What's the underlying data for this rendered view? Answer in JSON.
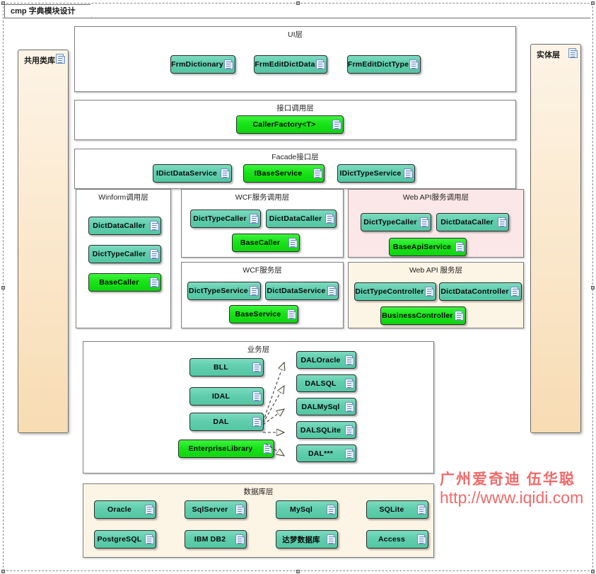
{
  "diagram": {
    "tab_title": "cmp 字典模块设计",
    "watermark_cn": "广州爱奇迪  伍华聪",
    "watermark_url": "http://www.iqidi.com"
  },
  "side_packages": [
    {
      "label": "共用类库",
      "icon": "document-icon"
    },
    {
      "label": "实体层",
      "icon": "document-icon"
    }
  ],
  "groups": [
    {
      "id": "ui",
      "title": "UI层",
      "bg": "white",
      "nodes": [
        {
          "label": "FrmDictionary",
          "style": "teal"
        },
        {
          "label": "FrmEditDictData",
          "style": "teal"
        },
        {
          "label": "FrmEditDictType",
          "style": "teal"
        }
      ]
    },
    {
      "id": "caller",
      "title": "接口调用层",
      "bg": "white",
      "nodes": [
        {
          "label": "CallerFactory<T>",
          "style": "lime"
        }
      ]
    },
    {
      "id": "facade",
      "title": "Facade接口层",
      "bg": "white",
      "nodes": [
        {
          "label": "IDictDataService",
          "style": "teal"
        },
        {
          "label": "IBaseService",
          "style": "lime"
        },
        {
          "label": "IDictTypeService",
          "style": "teal"
        }
      ]
    },
    {
      "id": "winform",
      "title": "Winform调用层",
      "bg": "white",
      "nodes": [
        {
          "label": "DictDataCaller",
          "style": "teal"
        },
        {
          "label": "DictTypeCaller",
          "style": "teal"
        },
        {
          "label": "BaseCaller",
          "style": "lime"
        }
      ]
    },
    {
      "id": "wcf-caller",
      "title": "WCF服务调用层",
      "bg": "white",
      "nodes": [
        {
          "label": "DictTypeCaller",
          "style": "teal"
        },
        {
          "label": "DictDataCaller",
          "style": "teal"
        },
        {
          "label": "BaseCaller",
          "style": "lime"
        }
      ]
    },
    {
      "id": "wcf-service",
      "title": "WCF服务层",
      "bg": "white",
      "nodes": [
        {
          "label": "DictTypeService",
          "style": "teal"
        },
        {
          "label": "DictDataService",
          "style": "teal"
        },
        {
          "label": "BaseService",
          "style": "lime"
        }
      ]
    },
    {
      "id": "webapi-caller",
      "title": "Web API服务调用层",
      "bg": "pink",
      "nodes": [
        {
          "label": "DictTypeCaller",
          "style": "teal"
        },
        {
          "label": "DictDataCaller",
          "style": "teal"
        },
        {
          "label": "BaseApiService",
          "style": "lime"
        }
      ]
    },
    {
      "id": "webapi-service",
      "title": "Web API 服务层",
      "bg": "cream",
      "nodes": [
        {
          "label": "DictTypeController",
          "style": "teal"
        },
        {
          "label": "DictDataController",
          "style": "teal"
        },
        {
          "label": "BusinessController",
          "style": "lime"
        }
      ]
    },
    {
      "id": "business",
      "title": "业务层",
      "bg": "white",
      "nodes": [
        {
          "label": "BLL",
          "style": "teal"
        },
        {
          "label": "IDAL",
          "style": "teal"
        },
        {
          "label": "DAL",
          "style": "teal"
        },
        {
          "label": "EnterpriseLibrary",
          "style": "lime"
        },
        {
          "label": "DALOracle",
          "style": "teal"
        },
        {
          "label": "DALSQL",
          "style": "teal"
        },
        {
          "label": "DALMySql",
          "style": "teal"
        },
        {
          "label": "DALSQLite",
          "style": "teal"
        },
        {
          "label": "DAL***",
          "style": "teal"
        }
      ]
    },
    {
      "id": "database",
      "title": "数据库层",
      "bg": "cream",
      "nodes": [
        {
          "label": "Oracle",
          "style": "teal"
        },
        {
          "label": "SqlServer",
          "style": "teal"
        },
        {
          "label": "MySql",
          "style": "teal"
        },
        {
          "label": "SQLite",
          "style": "teal"
        },
        {
          "label": "PostgreSQL",
          "style": "teal"
        },
        {
          "label": "IBM DB2",
          "style": "teal"
        },
        {
          "label": "达梦数据库",
          "style": "teal"
        },
        {
          "label": "Access",
          "style": "teal"
        }
      ]
    }
  ],
  "relations": [
    {
      "from": "DAL",
      "to": "DALOracle",
      "type": "realization"
    },
    {
      "from": "DAL",
      "to": "DALSQL",
      "type": "realization"
    },
    {
      "from": "DAL",
      "to": "DALMySql",
      "type": "realization"
    },
    {
      "from": "DAL",
      "to": "DALSQLite",
      "type": "realization"
    },
    {
      "from": "DAL",
      "to": "DAL***",
      "type": "realization"
    }
  ],
  "colors": {
    "teal_node": "#5ccda8",
    "lime_node": "#18e418",
    "pink_group": "#fbe7e7",
    "cream_group": "#fcf4e4",
    "side_panel": "#fbe9cf",
    "watermark": "#f06a6a"
  }
}
